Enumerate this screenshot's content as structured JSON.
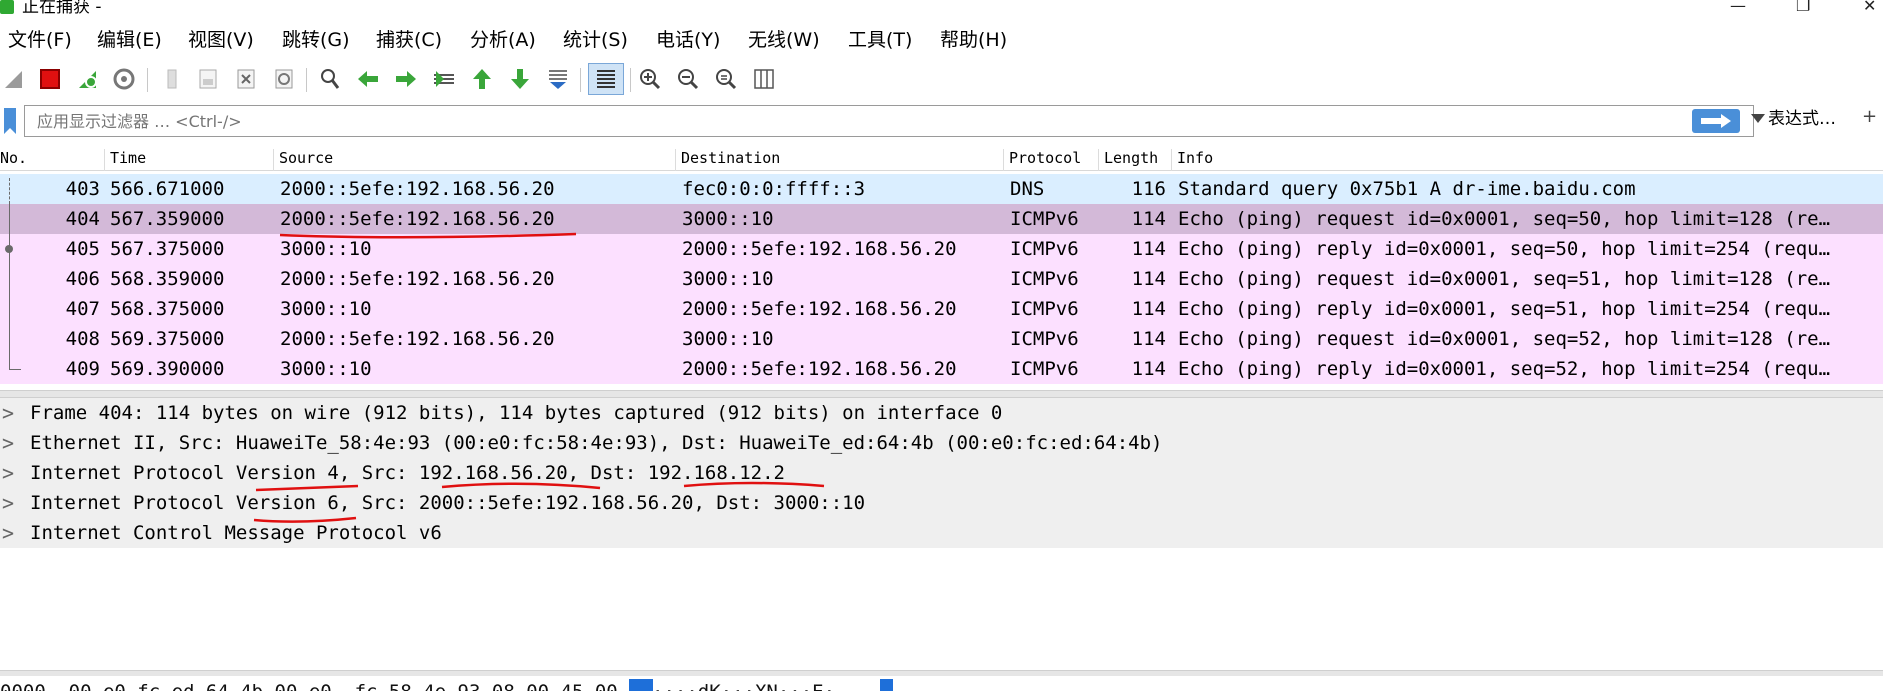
{
  "window": {
    "title": "正在捕获 -",
    "minimize_glyph": "—",
    "maximize_glyph": "❐",
    "close_glyph": "✕"
  },
  "menu": [
    {
      "label": "文件(F)"
    },
    {
      "label": "编辑(E)"
    },
    {
      "label": "视图(V)"
    },
    {
      "label": "跳转(G)"
    },
    {
      "label": "捕获(C)"
    },
    {
      "label": "分析(A)"
    },
    {
      "label": "统计(S)"
    },
    {
      "label": "电话(Y)"
    },
    {
      "label": "无线(W)"
    },
    {
      "label": "工具(T)"
    },
    {
      "label": "帮助(H)"
    }
  ],
  "toolbar": {
    "icons": [
      "start-capture-icon",
      "stop-capture-icon",
      "restart-capture-icon",
      "capture-options-icon",
      "open-file-icon",
      "save-file-icon",
      "close-file-icon",
      "reload-file-icon",
      "find-packet-icon",
      "go-back-icon",
      "go-forward-icon",
      "go-to-packet-icon",
      "go-first-icon",
      "go-last-icon",
      "auto-scroll-icon",
      "colorize-icon",
      "zoom-in-icon",
      "zoom-out-icon",
      "zoom-normal-icon",
      "resize-columns-icon"
    ],
    "colors": {
      "stop": "#e01010",
      "green_arrow": "#3aa63a",
      "blue_hl": "#cfe3f6"
    }
  },
  "filter": {
    "placeholder": "应用显示过滤器 … <Ctrl-/>",
    "expression_label": "表达式…",
    "plus_label": "+"
  },
  "packet_list": {
    "columns": [
      "No.",
      "Time",
      "Source",
      "Destination",
      "Protocol",
      "Length",
      "Info"
    ],
    "rows": [
      {
        "no": "403",
        "time": "566.671000",
        "src": "2000::5efe:192.168.56.20",
        "dst": "fec0:0:0:ffff::3",
        "proto": "DNS",
        "len": "116",
        "info": "Standard query 0x75b1 A dr-ime.baidu.com",
        "kind": "dns"
      },
      {
        "no": "404",
        "time": "567.359000",
        "src": "2000::5efe:192.168.56.20",
        "dst": "3000::10",
        "proto": "ICMPv6",
        "len": "114",
        "info": "Echo (ping) request id=0x0001, seq=50, hop limit=128 (re…",
        "kind": "selected"
      },
      {
        "no": "405",
        "time": "567.375000",
        "src": "3000::10",
        "dst": "2000::5efe:192.168.56.20",
        "proto": "ICMPv6",
        "len": "114",
        "info": "Echo (ping) reply id=0x0001, seq=50, hop limit=254 (requ…",
        "kind": "icmp"
      },
      {
        "no": "406",
        "time": "568.359000",
        "src": "2000::5efe:192.168.56.20",
        "dst": "3000::10",
        "proto": "ICMPv6",
        "len": "114",
        "info": "Echo (ping) request id=0x0001, seq=51, hop limit=128 (re…",
        "kind": "icmp"
      },
      {
        "no": "407",
        "time": "568.375000",
        "src": "3000::10",
        "dst": "2000::5efe:192.168.56.20",
        "proto": "ICMPv6",
        "len": "114",
        "info": "Echo (ping) reply id=0x0001, seq=51, hop limit=254 (requ…",
        "kind": "icmp"
      },
      {
        "no": "408",
        "time": "569.375000",
        "src": "2000::5efe:192.168.56.20",
        "dst": "3000::10",
        "proto": "ICMPv6",
        "len": "114",
        "info": "Echo (ping) request id=0x0001, seq=52, hop limit=128 (re…",
        "kind": "icmp"
      },
      {
        "no": "409",
        "time": "569.390000",
        "src": "3000::10",
        "dst": "2000::5efe:192.168.56.20",
        "proto": "ICMPv6",
        "len": "114",
        "info": "Echo (ping) reply id=0x0001, seq=52, hop limit=254 (requ…",
        "kind": "icmp"
      }
    ],
    "row_colors": {
      "dns": "#daeeff",
      "icmp": "#fce0ff",
      "selected": "#d3b9d8"
    }
  },
  "details": {
    "chevron": ">",
    "rows": [
      {
        "text": "Frame 404: 114 bytes on wire (912 bits), 114 bytes captured (912 bits) on interface 0"
      },
      {
        "text": "Ethernet II, Src: HuaweiTe_58:4e:93 (00:e0:fc:58:4e:93), Dst: HuaweiTe_ed:64:4b (00:e0:fc:ed:64:4b)"
      },
      {
        "text": "Internet Protocol Version 4, Src: 192.168.56.20, Dst: 192.168.12.2"
      },
      {
        "text": "Internet Protocol Version 6, Src: 2000::5efe:192.168.56.20, Dst: 3000::10"
      },
      {
        "text": "Internet Control Message Protocol v6"
      }
    ]
  },
  "bytes_pane": {
    "line": "0000  00 e0 fc ed 64 4b 00 e0  fc 58 4e 93 08 00 45 00   ····dK···XN···E·"
  },
  "annotation_color": "#e01010"
}
